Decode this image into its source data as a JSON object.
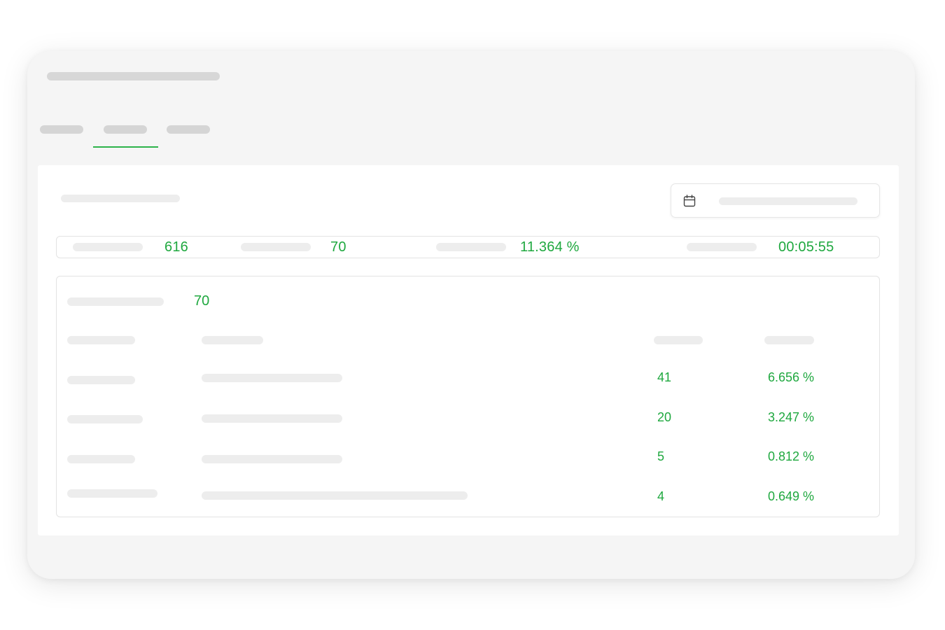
{
  "tabs": [
    {
      "label": "",
      "active": false
    },
    {
      "label": "",
      "active": true
    },
    {
      "label": "",
      "active": false
    }
  ],
  "date_range": {
    "value": ""
  },
  "stats": [
    {
      "label": "",
      "value": "616"
    },
    {
      "label": "",
      "value": "70"
    },
    {
      "label": "",
      "value": "11.364 %"
    },
    {
      "label": "",
      "value": "00:05:55"
    }
  ],
  "table": {
    "total_label": "",
    "total_value": "70",
    "rows": [
      {
        "count": "41",
        "percent": "6.656 %"
      },
      {
        "count": "20",
        "percent": "3.247 %"
      },
      {
        "count": "5",
        "percent": "0.812 %"
      },
      {
        "count": "4",
        "percent": "0.649 %"
      }
    ]
  },
  "colors": {
    "accent": "#1fa83f",
    "placeholder": "#dcdcdc",
    "window_bg": "#f5f5f5"
  },
  "icons": {
    "date_picker": "calendar-icon"
  }
}
